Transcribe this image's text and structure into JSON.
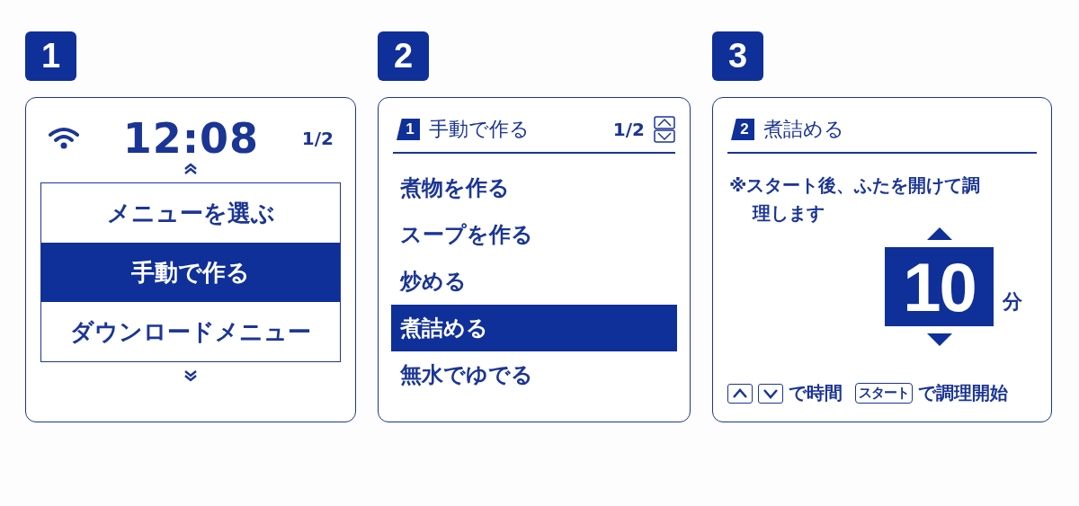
{
  "steps": [
    {
      "number": "1",
      "kind": "home",
      "clock": "12:08",
      "page": "1/2",
      "menu": [
        {
          "label": "メニューを選ぶ",
          "selected": false
        },
        {
          "label": "手動で作る",
          "selected": true
        },
        {
          "label": "ダウンロードメニュー",
          "selected": false
        }
      ]
    },
    {
      "number": "2",
      "kind": "list",
      "header": {
        "index": "1",
        "title": "手動で作る",
        "page": "1/2"
      },
      "items": [
        {
          "label": "煮物を作る",
          "selected": false
        },
        {
          "label": "スープを作る",
          "selected": false
        },
        {
          "label": "炒める",
          "selected": false
        },
        {
          "label": "煮詰める",
          "selected": true
        },
        {
          "label": "無水でゆでる",
          "selected": false
        }
      ]
    },
    {
      "number": "3",
      "kind": "timer",
      "header": {
        "index": "2",
        "title": "煮詰める"
      },
      "note": "※スタート後、ふたを開けて調理します",
      "value": "10",
      "unit": "分",
      "footer": [
        {
          "kind": "up-key"
        },
        {
          "kind": "down-key"
        },
        {
          "kind": "text",
          "text": "で時間"
        },
        {
          "kind": "key",
          "text": "スタート"
        },
        {
          "kind": "text",
          "text": "で調理開始"
        }
      ]
    }
  ]
}
